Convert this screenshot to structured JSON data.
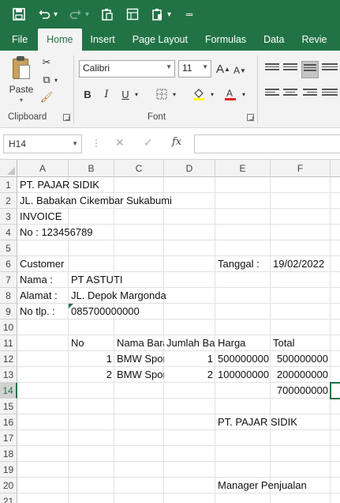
{
  "colors": {
    "brand": "#217346",
    "ribbon": "#f3f3f3"
  },
  "qat": {
    "icons": [
      "save-icon",
      "undo-icon",
      "redo-icon",
      "paste-icon",
      "format-painter-icon",
      "paste-special-icon",
      "customize-icon"
    ]
  },
  "tabs": [
    "File",
    "Home",
    "Insert",
    "Page Layout",
    "Formulas",
    "Data",
    "Revie"
  ],
  "active_tab": "Home",
  "ribbon": {
    "paste_label": "Paste",
    "clipboard_label": "Clipboard",
    "font_label": "Font",
    "font_name": "Calibri",
    "font_size": "11",
    "bold": "B",
    "italic": "I",
    "underline": "U",
    "grow_font": "A",
    "shrink_font": "A"
  },
  "formula_bar": {
    "name_box": "H14",
    "fx": "fx",
    "value": ""
  },
  "columns": [
    "A",
    "B",
    "C",
    "D",
    "E",
    "F"
  ],
  "rows": [
    "1",
    "2",
    "3",
    "4",
    "5",
    "6",
    "7",
    "8",
    "9",
    "10",
    "11",
    "12",
    "13",
    "14",
    "15",
    "16",
    "17",
    "18",
    "19",
    "20",
    "21"
  ],
  "selected_row": "14",
  "cells": {
    "a1": "PT. PAJAR SIDIK",
    "a2": "JL. Babakan Cikembar Sukabumi",
    "a3": "INVOICE",
    "a4": "No : 123456789",
    "a6": "Customer",
    "e6": "Tanggal :",
    "f6": "19/02/2022",
    "a7": "Nama :",
    "b7": "PT ASTUTI",
    "a8": "Alamat :",
    "b8": "JL. Depok Margonda",
    "a9": "No tlp. :",
    "b9": "085700000000",
    "b11": "No",
    "c11": "Nama Barang",
    "d11": "Jumlah Barang",
    "e11": "Harga",
    "f11": "Total",
    "b12": "1",
    "c12": "BMW Sport",
    "d12": "1",
    "e12": "500000000",
    "f12": "500000000",
    "b13": "2",
    "c13": "BMW Sport",
    "d13": "2",
    "e13": "100000000",
    "f13": "200000000",
    "f14": "700000000",
    "e16": "PT. PAJAR SIDIK",
    "e20": "Manager Penjualan"
  }
}
